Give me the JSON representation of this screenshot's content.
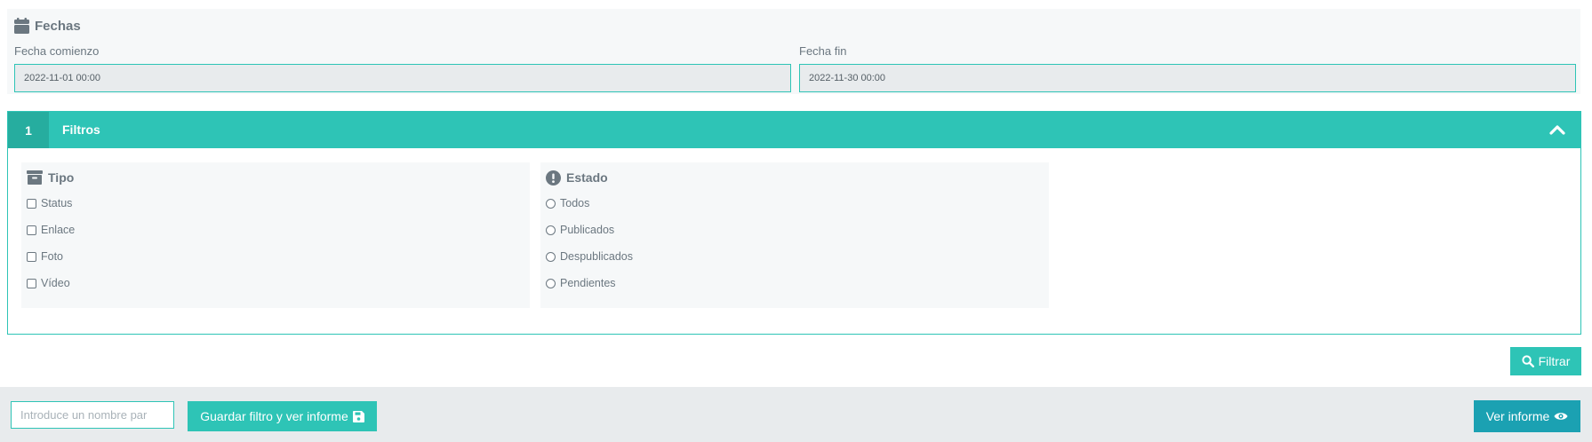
{
  "dates": {
    "title": "Fechas",
    "title_icon": "calendar-icon",
    "start_label": "Fecha comienzo",
    "start_value": "2022-11-01 00:00",
    "end_label": "Fecha fin",
    "end_value": "2022-11-30 00:00"
  },
  "filters": {
    "step_number": "1",
    "title": "Filtros",
    "collapse_icon": "chevron-up-icon",
    "tipo": {
      "title": "Tipo",
      "icon": "archive-box-icon",
      "options": [
        {
          "label": "Status",
          "checked": false
        },
        {
          "label": "Enlace",
          "checked": false
        },
        {
          "label": "Foto",
          "checked": false
        },
        {
          "label": "Vídeo",
          "checked": false
        }
      ]
    },
    "estado": {
      "title": "Estado",
      "icon": "exclamation-circle-icon",
      "options": [
        {
          "label": "Todos",
          "selected": false
        },
        {
          "label": "Publicados",
          "selected": false
        },
        {
          "label": "Despublicados",
          "selected": false
        },
        {
          "label": "Pendientes",
          "selected": false
        }
      ]
    },
    "filter_button_label": "Filtrar",
    "filter_button_icon": "search-icon"
  },
  "footer": {
    "name_placeholder": "Introduce un nombre par",
    "name_value": "",
    "save_button_label": "Guardar filtro y ver informe",
    "save_button_icon": "floppy-disk-icon",
    "view_button_label": "Ver informe",
    "view_button_icon": "eye-icon"
  },
  "colors": {
    "accent": "#2ec4b6",
    "accent_dark": "#26ad9f",
    "view_button": "#1ba1b2",
    "text": "#6b7780",
    "panel_bg": "#f6f8f9",
    "footer_bg": "#e8ebed"
  }
}
